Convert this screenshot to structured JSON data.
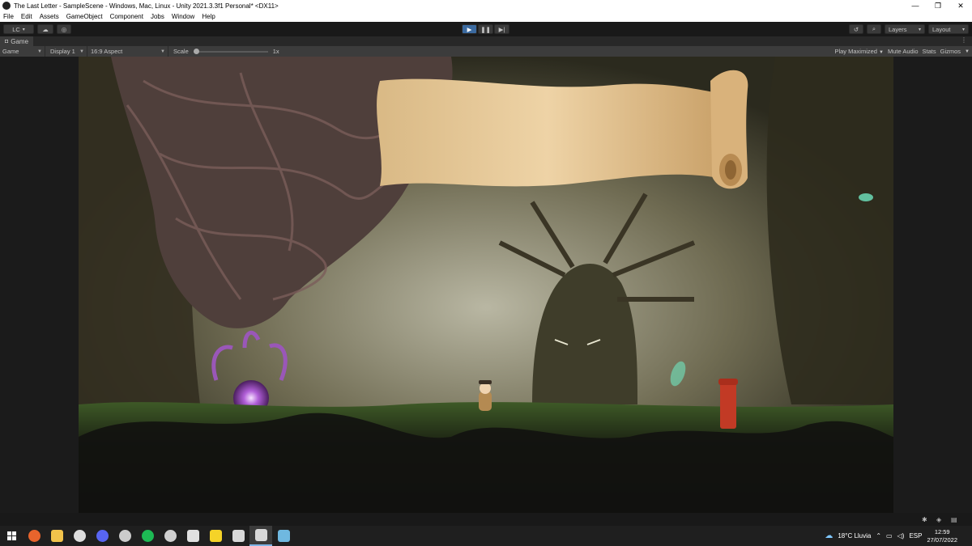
{
  "window": {
    "title": "The Last Letter - SampleScene - Windows, Mac, Linux - Unity 2021.3.3f1 Personal* <DX11>",
    "controls": [
      "—",
      "❐",
      "✕"
    ]
  },
  "menu": [
    "File",
    "Edit",
    "Assets",
    "GameObject",
    "Component",
    "Jobs",
    "Window",
    "Help"
  ],
  "toolbar": {
    "account_label": "LC",
    "layers_label": "Layers",
    "layout_label": "Layout"
  },
  "tab": {
    "label": "Game"
  },
  "gamebar": {
    "mode": "Game",
    "display": "Display 1",
    "aspect": "16:9 Aspect",
    "scale_label": "Scale",
    "scale_value": "1x",
    "play_mode": "Play Maximized",
    "mute": "Mute Audio",
    "stats": "Stats",
    "gizmos": "Gizmos"
  },
  "taskbar": {
    "apps": [
      {
        "name": "firefox-icon",
        "color": "#e8642c"
      },
      {
        "name": "file-explorer-icon",
        "color": "#f2c34b"
      },
      {
        "name": "steam-icon",
        "color": "#dddddd"
      },
      {
        "name": "discord-icon",
        "color": "#5865f2"
      },
      {
        "name": "search-app-icon",
        "color": "#cccccc"
      },
      {
        "name": "spotify-icon",
        "color": "#1db954"
      },
      {
        "name": "settings-icon",
        "color": "#d0d0d0"
      },
      {
        "name": "unity-hub-icon",
        "color": "#e0e0e0"
      },
      {
        "name": "sticky-notes-icon",
        "color": "#f5d328"
      },
      {
        "name": "unity-icon",
        "color": "#d8d8d8"
      },
      {
        "name": "unity-editor-icon",
        "color": "#d8d8d8"
      },
      {
        "name": "notes-app-icon",
        "color": "#6fb8e0"
      }
    ],
    "weather": "18°C  Lluvia",
    "language": "ESP",
    "time": "12:59",
    "date": "27/07/2022"
  },
  "colors": {
    "editor_bg": "#191919",
    "toolbar_accent": "#3b6aa0",
    "forest_dark": "#2b2a1e",
    "grass": "#3e5a27",
    "scroll": "#e6c797"
  }
}
